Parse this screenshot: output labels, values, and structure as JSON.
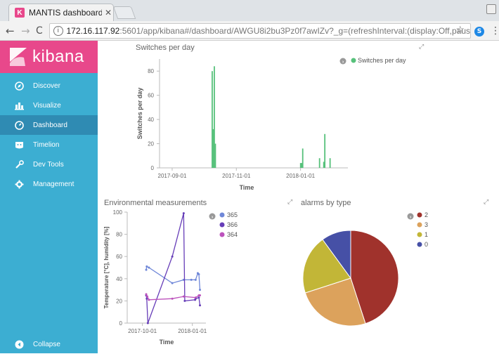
{
  "browser": {
    "tab_title": "MANTIS dashboard",
    "tab_favicon_letter": "K",
    "url_host": "172.16.117.92",
    "url_rest": ":5601/app/kibana#/dashboard/AWGU8i2bu3Pz0f7awIZv?_g=(refreshInterval:(display:Off,pause:!f,value..."
  },
  "sidebar": {
    "logo_text": "kibana",
    "items": [
      {
        "label": "Discover",
        "icon": "compass-icon"
      },
      {
        "label": "Visualize",
        "icon": "bar-chart-icon"
      },
      {
        "label": "Dashboard",
        "icon": "dashboard-icon",
        "active": true
      },
      {
        "label": "Timelion",
        "icon": "timelion-icon"
      },
      {
        "label": "Dev Tools",
        "icon": "wrench-icon"
      },
      {
        "label": "Management",
        "icon": "gear-icon"
      }
    ],
    "collapse_label": "Collapse"
  },
  "colors": {
    "sidebar": "#3caed2",
    "sidebar_active": "#2f8bb3",
    "logo": "#e8488b",
    "switches": "#57c17b",
    "s365": "#6f87d8",
    "s366": "#663db8",
    "s364": "#bc52bc",
    "a2": "#a0322c",
    "a3": "#dca25c",
    "a1": "#c2b637",
    "a0": "#4650a6"
  },
  "panels": {
    "switches": {
      "title": "Switches per day"
    },
    "environment": {
      "title": "Environmental measurements"
    },
    "alarms": {
      "title": "alarms by type"
    }
  },
  "chart_data": [
    {
      "type": "bar",
      "title": "Switches per day",
      "xlabel": "Time",
      "ylabel": "Switches per day",
      "ylim": [
        0,
        90
      ],
      "y_ticks": [
        0,
        20,
        40,
        60,
        80
      ],
      "x_ticks": [
        "2017-09-01",
        "2017-11-01",
        "2018-01-01"
      ],
      "x": [
        "2017-10-09",
        "2017-10-10",
        "2017-10-11",
        "2017-10-12",
        "2018-01-01",
        "2018-01-02",
        "2018-01-03",
        "2018-01-19",
        "2018-01-23",
        "2018-01-24",
        "2018-01-29"
      ],
      "series": [
        {
          "name": "Switches per day",
          "values": [
            80,
            32,
            84,
            20,
            4,
            4,
            16,
            8,
            5,
            28,
            8
          ]
        }
      ],
      "legend_position": "top-right"
    },
    {
      "type": "line",
      "title": "Environmental measurements",
      "xlabel": "Time",
      "ylabel": "Temperature [°C], humidity [%]",
      "ylim": [
        0,
        100
      ],
      "y_ticks": [
        0,
        20,
        40,
        60,
        80,
        100
      ],
      "x_ticks": [
        "2017-10-01",
        "2018-01-01"
      ],
      "series": [
        {
          "name": "365",
          "points": [
            [
              "2017-10-08",
              48
            ],
            [
              "2017-10-09",
              51
            ],
            [
              "2017-10-13",
              50
            ],
            [
              "2017-11-25",
              36
            ],
            [
              "2017-12-16",
              39
            ],
            [
              "2017-12-30",
              39
            ],
            [
              "2018-01-07",
              39
            ],
            [
              "2018-01-11",
              45
            ],
            [
              "2018-01-13",
              44
            ],
            [
              "2018-01-15",
              30
            ]
          ]
        },
        {
          "name": "366",
          "points": [
            [
              "2017-10-08",
              25
            ],
            [
              "2017-10-09",
              22
            ],
            [
              "2017-10-11",
              0
            ],
            [
              "2017-11-25",
              60
            ],
            [
              "2017-12-16",
              99
            ],
            [
              "2017-12-18",
              20
            ],
            [
              "2018-01-06",
              21
            ],
            [
              "2018-01-07",
              22
            ],
            [
              "2018-01-13",
              23
            ],
            [
              "2018-01-15",
              16
            ]
          ]
        },
        {
          "name": "364",
          "points": [
            [
              "2017-10-08",
              26
            ],
            [
              "2017-10-10",
              24
            ],
            [
              "2017-10-13",
              21
            ],
            [
              "2017-11-25",
              22
            ],
            [
              "2017-12-16",
              24
            ],
            [
              "2018-01-07",
              23
            ],
            [
              "2018-01-13",
              25
            ],
            [
              "2018-01-15",
              25
            ]
          ]
        }
      ],
      "legend_position": "top-right"
    },
    {
      "type": "pie",
      "title": "alarms by type",
      "slices": [
        {
          "label": "2",
          "value": 45
        },
        {
          "label": "3",
          "value": 25
        },
        {
          "label": "1",
          "value": 20
        },
        {
          "label": "0",
          "value": 10
        }
      ],
      "legend_position": "top-right"
    }
  ]
}
